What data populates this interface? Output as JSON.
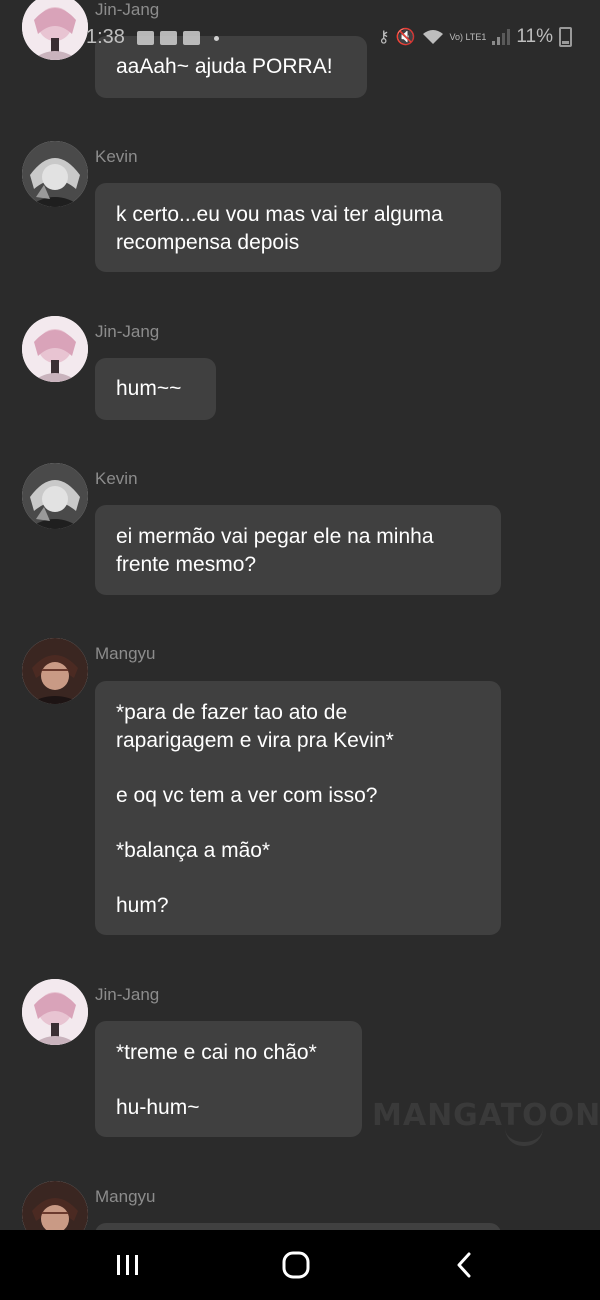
{
  "status_bar": {
    "time": "1:38",
    "battery": "11%",
    "network": "Vo) LTE1"
  },
  "messages": [
    {
      "sender": "Jin-Jang",
      "text": "aaAah~ ajuda PORRA!"
    },
    {
      "sender": "Kevin",
      "text": "k certo...eu vou mas vai ter alguma\nrecompensa depois"
    },
    {
      "sender": "Jin-Jang",
      "text": "hum~~"
    },
    {
      "sender": "Kevin",
      "text": "ei mermão vai pegar ele na minha\nfrente mesmo?"
    },
    {
      "sender": "Mangyu",
      "text": "*para de fazer tao ato de\nraparigagem e vira pra Kevin*\n\ne oq vc tem a ver com isso?\n\n*balança a mão*\n\nhum?"
    },
    {
      "sender": "Jin-Jang",
      "text": "*treme e cai no chão*\n\nhu-hum~"
    },
    {
      "sender": "Mangyu",
      "text": ""
    }
  ],
  "watermark": "MANGATOON",
  "nav": {
    "recents": "recent-apps-icon",
    "home": "home-icon",
    "back": "back-icon"
  }
}
